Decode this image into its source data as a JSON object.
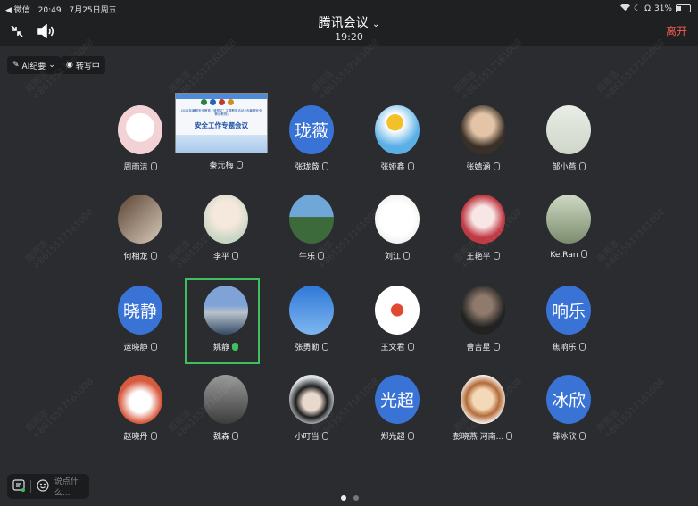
{
  "status": {
    "left": [
      "◀ 微信",
      "20:49",
      "7月25日周五"
    ],
    "battery": "31%"
  },
  "header": {
    "title": "腾讯会议",
    "time": "19:20",
    "leave": "离开"
  },
  "toolbar": {
    "ai": "AI纪要",
    "transcribe": "转写中"
  },
  "shared_screen": {
    "subtitle": "2025年暑期安全教育 “我预见” 主题教育活动 (含暑期安全警示教育)",
    "title": "安全工作专题会议"
  },
  "participants": [
    {
      "name": "周雨洁",
      "avatar": "hello-kitty-avatar"
    },
    {
      "name": "秦元梅",
      "avatar": "shared-screen"
    },
    {
      "name": "张珑薇",
      "avatar": "text",
      "text": "珑薇"
    },
    {
      "name": "张娅鑫",
      "avatar": "sunflower-doraemon-avatar"
    },
    {
      "name": "张婧涵",
      "avatar": "girl-photo-avatar"
    },
    {
      "name": "邹小燕",
      "avatar": "plant-avatar"
    },
    {
      "name": "何相龙",
      "avatar": "hand-avatar"
    },
    {
      "name": "李平",
      "avatar": "doll-avatar"
    },
    {
      "name": "牛乐",
      "avatar": "sky-landscape-avatar"
    },
    {
      "name": "刘江",
      "avatar": "white-flower-avatar"
    },
    {
      "name": "王艳平",
      "avatar": "anime-girl-avatar"
    },
    {
      "name": "Ke.Ran",
      "avatar": "figure-nature-avatar"
    },
    {
      "name": "运晓静",
      "avatar": "text",
      "text": "晓静"
    },
    {
      "name": "姚静",
      "avatar": "lake-photo-avatar"
    },
    {
      "name": "张勇勤",
      "avatar": "blue-sky-avatar"
    },
    {
      "name": "王文君",
      "avatar": "apple-avatar"
    },
    {
      "name": "曹吉星",
      "avatar": "dark-portrait-avatar"
    },
    {
      "name": "焦响乐",
      "avatar": "text",
      "text": "响乐"
    },
    {
      "name": "赵晓丹",
      "avatar": "rabbit-avatar"
    },
    {
      "name": "魏森",
      "avatar": "man-photo-avatar"
    },
    {
      "name": "小叮当",
      "avatar": "anime-boy-avatar"
    },
    {
      "name": "郑光超",
      "avatar": "text",
      "text": "光超"
    },
    {
      "name": "彭晓燕 河南...",
      "avatar": "cartoon-girl-avatar"
    },
    {
      "name": "薛冰欣",
      "avatar": "text",
      "text": "冰欣"
    }
  ],
  "watermark": {
    "name": "周雨洁",
    "phone": "+8615517161008"
  },
  "chat": {
    "placeholder": "说点什么..."
  },
  "colors": {
    "accent": "#3fbf5f",
    "leave": "#f05b4f",
    "text_avatar": "#3a73d6"
  }
}
